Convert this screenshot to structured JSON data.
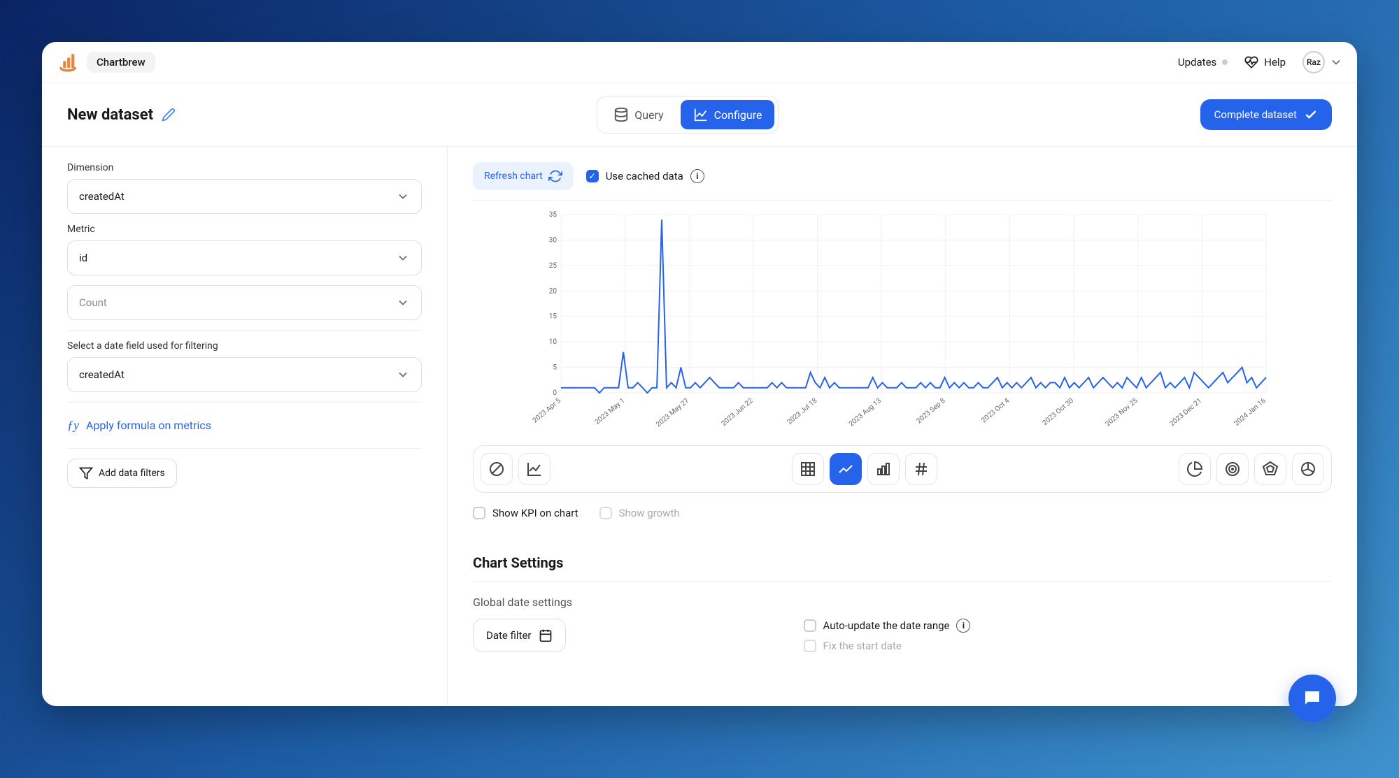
{
  "brand": "Chartbrew",
  "topbar": {
    "updates": "Updates",
    "help": "Help",
    "avatar_initials": "Raz"
  },
  "header": {
    "title": "New dataset",
    "tabs": {
      "query": "Query",
      "configure": "Configure"
    },
    "complete_btn": "Complete dataset"
  },
  "left": {
    "dimension_label": "Dimension",
    "dimension_value": "createdAt",
    "metric_label": "Metric",
    "metric_value": "id",
    "aggregation_value": "Count",
    "date_field_label": "Select a date field used for filtering",
    "date_field_value": "createdAt",
    "formula_link": "Apply formula on metrics",
    "add_filters": "Add data filters"
  },
  "chart": {
    "refresh": "Refresh chart",
    "use_cached": "Use cached data",
    "show_kpi": "Show KPI on chart",
    "show_growth": "Show growth"
  },
  "chart_settings": {
    "title": "Chart Settings",
    "global_date": "Global date settings",
    "date_filter": "Date filter",
    "auto_update": "Auto-update the date range",
    "fix_start": "Fix the start date"
  },
  "chart_data": {
    "type": "line",
    "ylabel": "",
    "xlabel": "",
    "ylim": [
      0,
      35
    ],
    "yticks": [
      0,
      5,
      10,
      15,
      20,
      25,
      30,
      35
    ],
    "x_tick_labels": [
      "2023 Apr 5",
      "2023 May 1",
      "2023 May 27",
      "2023 Jun 22",
      "2023 Jul 18",
      "2023 Aug 13",
      "2023 Sep 8",
      "2023 Oct 4",
      "2023 Oct 30",
      "2023 Nov 25",
      "2023 Dec 21",
      "2024 Jan 16"
    ],
    "values": [
      1,
      1,
      1,
      1,
      1,
      1,
      1,
      1,
      0,
      1,
      1,
      1,
      1,
      8,
      1,
      1,
      2,
      1,
      0,
      1,
      1,
      34,
      1,
      2,
      1,
      5,
      1,
      1,
      2,
      1,
      2,
      3,
      2,
      1,
      1,
      1,
      1,
      2,
      1,
      1,
      1,
      1,
      1,
      1,
      2,
      1,
      2,
      1,
      1,
      1,
      1,
      1,
      4,
      2,
      1,
      3,
      1,
      2,
      1,
      1,
      1,
      1,
      1,
      1,
      1,
      3,
      1,
      2,
      1,
      1,
      1,
      2,
      1,
      1,
      1,
      2,
      1,
      2,
      1,
      1,
      3,
      1,
      2,
      1,
      2,
      1,
      1,
      2,
      1,
      1,
      2,
      3,
      1,
      2,
      1,
      2,
      1,
      2,
      3,
      1,
      2,
      1,
      2,
      2,
      1,
      3,
      1,
      2,
      1,
      2,
      3,
      1,
      2,
      3,
      2,
      1,
      2,
      1,
      3,
      2,
      1,
      3,
      1,
      2,
      3,
      4,
      1,
      2,
      1,
      2,
      3,
      1,
      4,
      3,
      2,
      1,
      2,
      3,
      4,
      2,
      3,
      4,
      5,
      2,
      3,
      1,
      2,
      3
    ]
  }
}
